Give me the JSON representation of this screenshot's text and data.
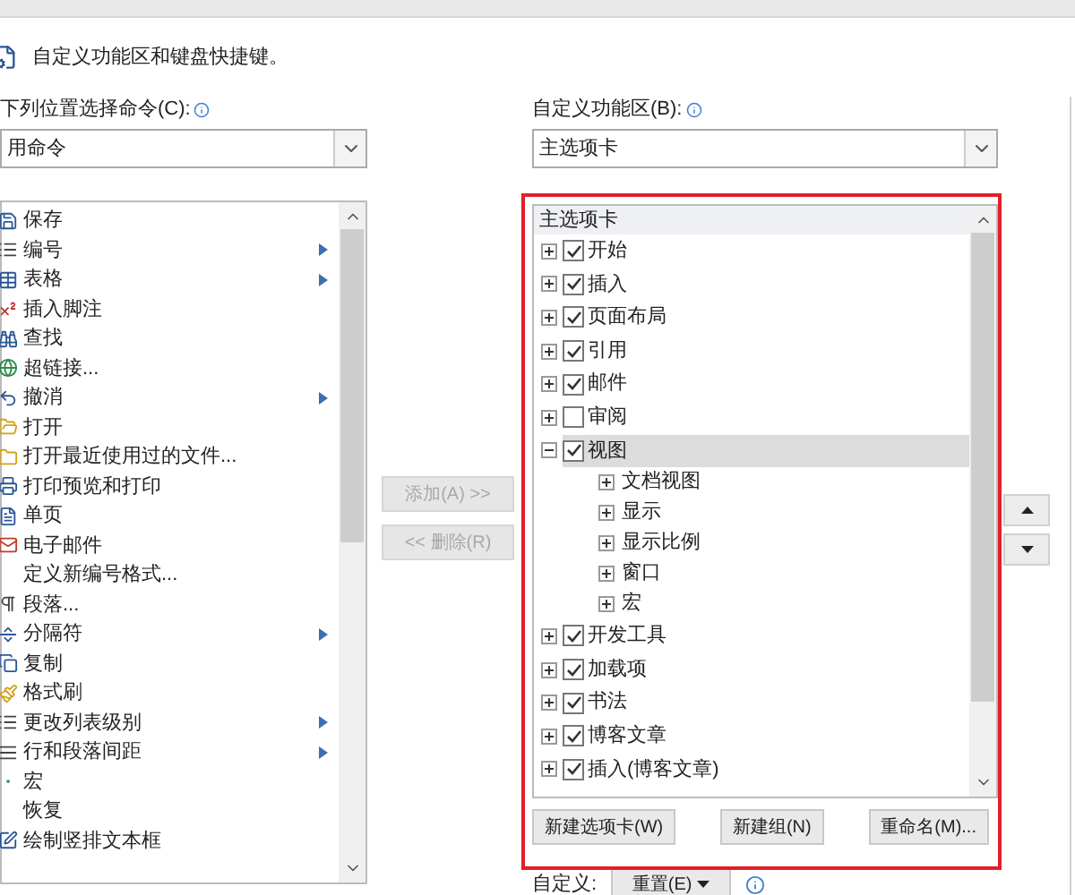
{
  "header": {
    "title": "自定义功能区和键盘快捷键。"
  },
  "left": {
    "label": "下列位置选择命令(C):",
    "dropdown": "用命令",
    "commands": [
      {
        "label": "保存",
        "kind": "save",
        "submenu": false
      },
      {
        "label": "编号",
        "kind": "list",
        "submenu": true
      },
      {
        "label": "表格",
        "kind": "table",
        "submenu": true
      },
      {
        "label": "插入脚注",
        "kind": "footnote",
        "submenu": false
      },
      {
        "label": "查找",
        "kind": "find",
        "submenu": false
      },
      {
        "label": "超链接...",
        "kind": "link",
        "submenu": false
      },
      {
        "label": "撤消",
        "kind": "undo",
        "submenu": true
      },
      {
        "label": "打开",
        "kind": "open",
        "submenu": false
      },
      {
        "label": "打开最近使用过的文件...",
        "kind": "folder",
        "submenu": false
      },
      {
        "label": "打印预览和打印",
        "kind": "print",
        "submenu": false
      },
      {
        "label": "单页",
        "kind": "page",
        "submenu": false
      },
      {
        "label": "电子邮件",
        "kind": "mail",
        "submenu": false
      },
      {
        "label": "定义新编号格式...",
        "kind": "none",
        "submenu": false
      },
      {
        "label": "段落...",
        "kind": "paragraph",
        "submenu": false
      },
      {
        "label": "分隔符",
        "kind": "break",
        "submenu": true
      },
      {
        "label": "复制",
        "kind": "copy",
        "submenu": false
      },
      {
        "label": "格式刷",
        "kind": "brush",
        "submenu": false
      },
      {
        "label": "更改列表级别",
        "kind": "list",
        "submenu": true
      },
      {
        "label": "行和段落间距",
        "kind": "spacing",
        "submenu": true
      },
      {
        "label": "宏",
        "kind": "macro",
        "submenu": false
      },
      {
        "label": "恢复",
        "kind": "none",
        "submenu": false
      },
      {
        "label": "绘制竖排文本框",
        "kind": "textbox",
        "submenu": false
      }
    ]
  },
  "middle": {
    "buttons": [
      {
        "label": "添加(A) >>",
        "disabled": true
      },
      {
        "label": "<< 删除(R)",
        "disabled": true
      }
    ]
  },
  "right": {
    "label": "自定义功能区(B):",
    "dropdown": "主选项卡",
    "tree_header": "主选项卡",
    "tree": [
      {
        "label": "开始",
        "checked": true,
        "expanded": false,
        "selected": false
      },
      {
        "label": "插入",
        "checked": true,
        "expanded": false,
        "selected": false
      },
      {
        "label": "页面布局",
        "checked": true,
        "expanded": false,
        "selected": false
      },
      {
        "label": "引用",
        "checked": true,
        "expanded": false,
        "selected": false
      },
      {
        "label": "邮件",
        "checked": true,
        "expanded": false,
        "selected": false
      },
      {
        "label": "审阅",
        "checked": false,
        "expanded": false,
        "selected": false
      },
      {
        "label": "视图",
        "checked": true,
        "expanded": true,
        "selected": true,
        "children": [
          {
            "label": "文档视图",
            "expanded": false
          },
          {
            "label": "显示",
            "expanded": false
          },
          {
            "label": "显示比例",
            "expanded": false
          },
          {
            "label": "窗口",
            "expanded": false
          },
          {
            "label": "宏",
            "expanded": false
          }
        ]
      },
      {
        "label": "开发工具",
        "checked": true,
        "expanded": false,
        "selected": false
      },
      {
        "label": "加载项",
        "checked": true,
        "expanded": false,
        "selected": false
      },
      {
        "label": "书法",
        "checked": true,
        "expanded": false,
        "selected": false
      },
      {
        "label": "博客文章",
        "checked": true,
        "expanded": false,
        "selected": false
      },
      {
        "label": "插入(博客文章)",
        "checked": true,
        "expanded": false,
        "selected": false
      }
    ],
    "buttons": [
      "新建选项卡(W)",
      "新建组(N)",
      "重命名(M)..."
    ],
    "customize_label": "自定义:",
    "reset_button": "重置(E)"
  }
}
